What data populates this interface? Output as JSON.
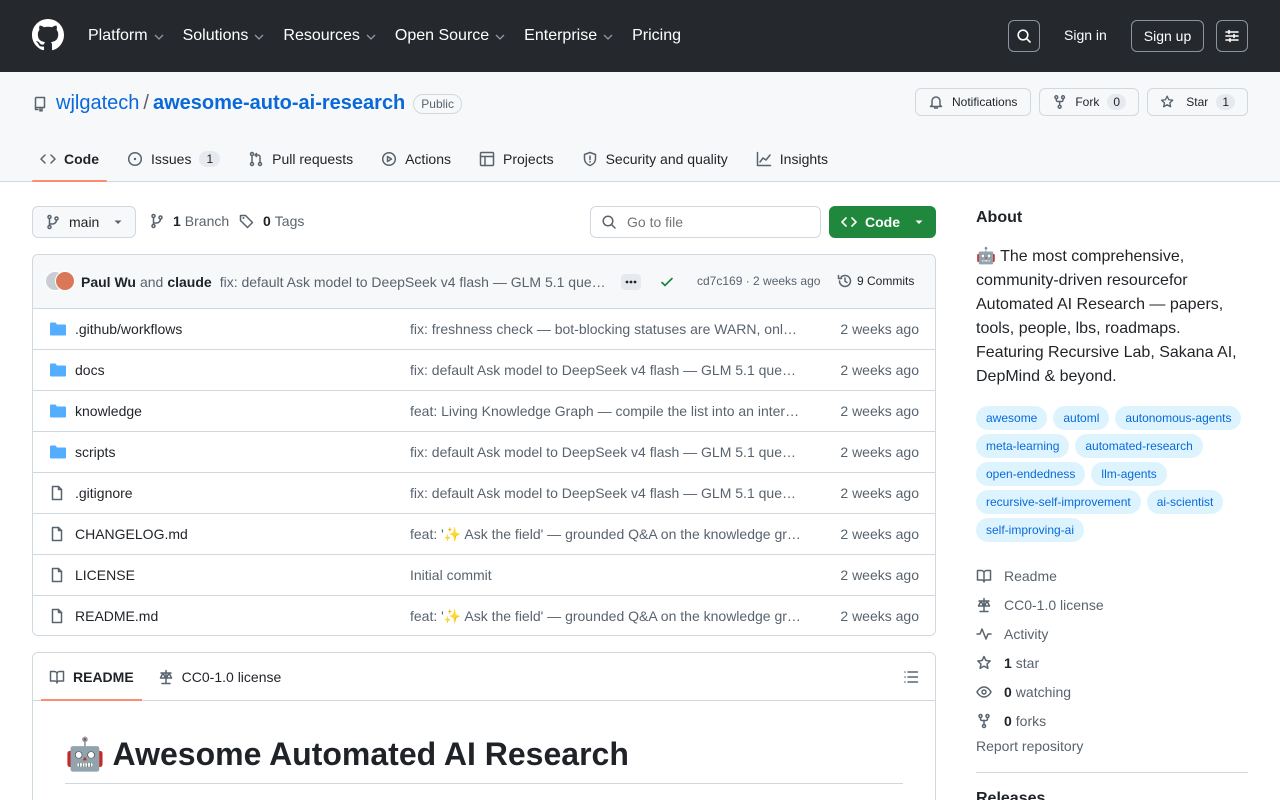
{
  "header": {
    "nav": [
      "Platform",
      "Solutions",
      "Resources",
      "Open Source",
      "Enterprise",
      "Pricing"
    ],
    "sign_in": "Sign in",
    "sign_up": "Sign up"
  },
  "repo": {
    "owner": "wjlgatech",
    "separator": "/",
    "name": "awesome-auto-ai-research",
    "visibility": "Public",
    "notifications_label": "Notifications",
    "fork_label": "Fork",
    "fork_count": "0",
    "star_label": "Star",
    "star_count": "1"
  },
  "tabs": [
    {
      "label": "Code",
      "icon": "code-icon"
    },
    {
      "label": "Issues",
      "icon": "issue-icon",
      "count": "1"
    },
    {
      "label": "Pull requests",
      "icon": "pull-request-icon"
    },
    {
      "label": "Actions",
      "icon": "play-icon"
    },
    {
      "label": "Projects",
      "icon": "table-icon"
    },
    {
      "label": "Security and quality",
      "icon": "shield-icon"
    },
    {
      "label": "Insights",
      "icon": "graph-icon"
    }
  ],
  "toolbar": {
    "branch": "main",
    "branch_count": "1",
    "branch_label": "Branch",
    "tag_count": "0",
    "tag_label": "Tags",
    "goto_placeholder": "Go to file",
    "code_button": "Code"
  },
  "latest_commit": {
    "author1": "Paul Wu",
    "and": "and",
    "author2": "claude",
    "message": "fix: default Ask model to DeepSeek v4 flash — GLM 5.1 que…",
    "sha": "cd7c169 · 2 weeks ago",
    "commits": "9 Commits"
  },
  "files": [
    {
      "type": "dir",
      "name": ".github/workflows",
      "message": "fix: freshness check — bot-blocking statuses are WARN, only real breakage fails",
      "date": "2 weeks ago"
    },
    {
      "type": "dir",
      "name": "docs",
      "message": "fix: default Ask model to DeepSeek v4 flash — GLM 5.1 que…",
      "date": "2 weeks ago"
    },
    {
      "type": "dir",
      "name": "knowledge",
      "message": "feat: Living Knowledge Graph — compile the list into an interactive map",
      "date": "2 weeks ago"
    },
    {
      "type": "dir",
      "name": "scripts",
      "message": "fix: default Ask model to DeepSeek v4 flash — GLM 5.1 que…",
      "date": "2 weeks ago"
    },
    {
      "type": "file",
      "name": ".gitignore",
      "message": "fix: default Ask model to DeepSeek v4 flash — GLM 5.1 que…",
      "date": "2 weeks ago"
    },
    {
      "type": "file",
      "name": "CHANGELOG.md",
      "message": "feat: '✨ Ask the field' — grounded Q&A on the knowledge graph",
      "date": "2 weeks ago"
    },
    {
      "type": "file",
      "name": "LICENSE",
      "message": "Initial commit",
      "date": "2 weeks ago"
    },
    {
      "type": "file",
      "name": "README.md",
      "message": "feat: '✨ Ask the field' — grounded Q&A on the knowledge graph",
      "date": "2 weeks ago"
    }
  ],
  "readme": {
    "tab_readme": "README",
    "tab_license": "CC0-1.0 license",
    "heading": "🤖 Awesome Automated AI Research"
  },
  "about": {
    "title": "About",
    "description": "🤖 The most comprehensive, community-driven resourcefor Automated AI Research — papers, tools, people, lbs, roadmaps. Featuring Recursive Lab, Sakana AI, DepMind & beyond.",
    "topics": [
      "awesome",
      "automl",
      "autonomous-agents",
      "meta-learning",
      "automated-research",
      "open-endedness",
      "llm-agents",
      "recursive-self-improvement",
      "ai-scientist",
      "self-improving-ai"
    ],
    "readme": "Readme",
    "license": "CC0-1.0 license",
    "activity": "Activity",
    "stars_count": "1",
    "stars_label": "star",
    "watching_count": "0",
    "watching_label": "watching",
    "forks_count": "0",
    "forks_label": "forks",
    "report": "Report repository",
    "releases": "Releases"
  }
}
